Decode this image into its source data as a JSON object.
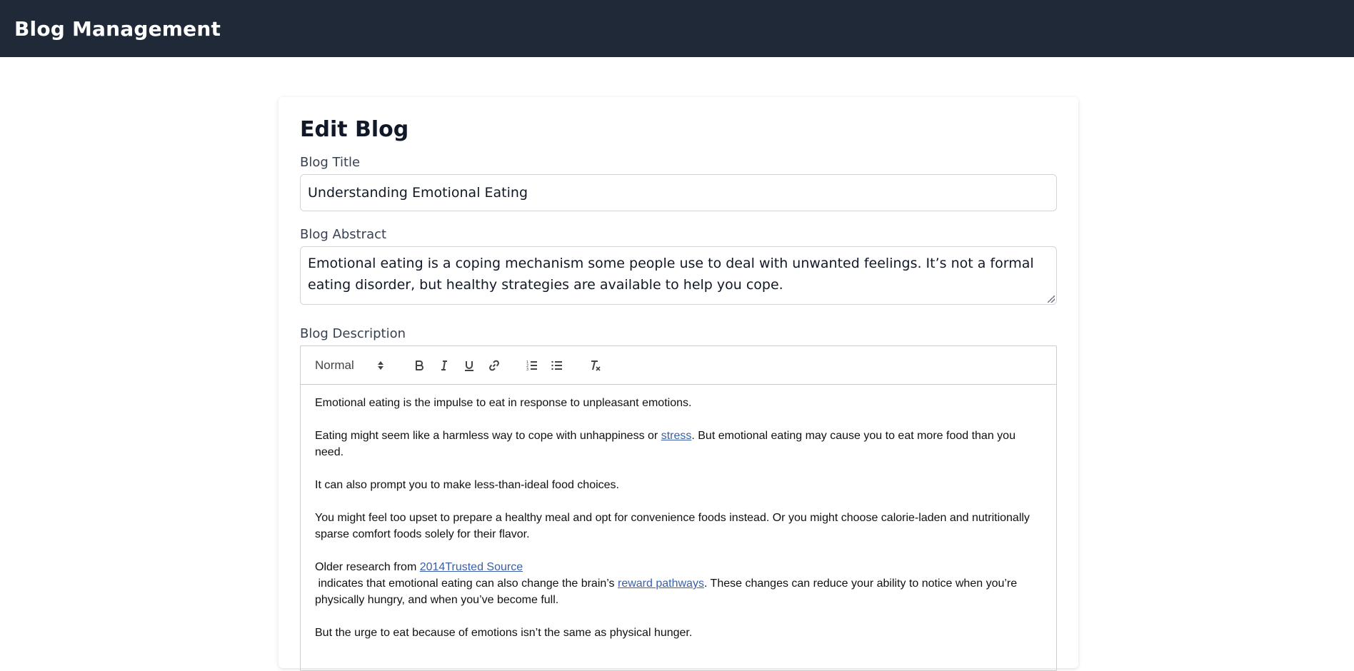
{
  "header": {
    "app_title": "Blog Management"
  },
  "page": {
    "heading": "Edit Blog"
  },
  "form": {
    "title_label": "Blog Title",
    "title_value": "Understanding Emotional Eating",
    "abstract_label": "Blog Abstract",
    "abstract_value": "Emotional eating is a coping mechanism some people use to deal with unwanted feelings. It’s not a formal eating disorder, but healthy strategies are available to help you cope.",
    "description_label": "Blog Description"
  },
  "editor": {
    "toolbar": {
      "format_value": "Normal",
      "buttons": [
        "bold-icon",
        "italic-icon",
        "underline-icon",
        "link-icon",
        "ordered-list-icon",
        "bullet-list-icon",
        "clear-format-icon"
      ]
    },
    "paragraphs": {
      "p1": "Emotional eating is the impulse to eat in response to unpleasant emotions.",
      "p2_before": "Eating might seem like a harmless way to cope with unhappiness or ",
      "p2_link": "stress",
      "p2_after": ". But emotional eating may cause you to eat more food than you need.",
      "p3": "It can also prompt you to make less-than-ideal food choices.",
      "p4": "You might feel too upset to prepare a healthy meal and opt for convenience foods instead. Or you might choose calorie-laden and nutritionally sparse comfort foods solely for their flavor.",
      "p5_before": "Older research from ",
      "p5_link": "2014Trusted Source",
      "p6_before": " indicates that emotional eating can also change the brain’s ",
      "p6_link": "reward pathways",
      "p6_after": ". These changes can reduce your ability to notice when you’re physically hungry, and when you’ve become full.",
      "p7": "But the urge to eat because of emotions isn’t the same as physical hunger."
    }
  }
}
